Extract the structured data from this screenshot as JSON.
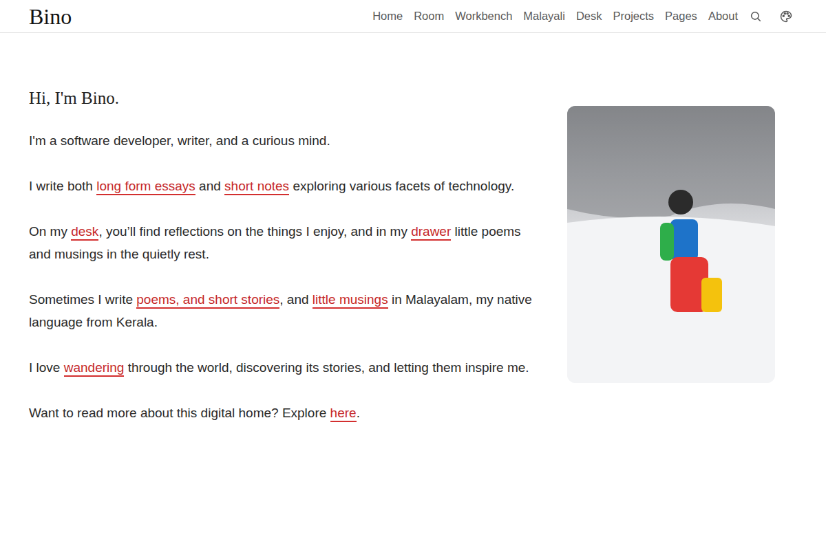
{
  "site": {
    "brand": "Bino"
  },
  "nav": {
    "items": [
      {
        "label": "Home",
        "selected": false
      },
      {
        "label": "Room",
        "selected": false
      },
      {
        "label": "Workbench",
        "selected": false
      },
      {
        "label": "Malayali",
        "selected": false
      },
      {
        "label": "Desk",
        "selected": false
      },
      {
        "label": "Projects",
        "selected": false
      },
      {
        "label": "Pages",
        "selected": false
      },
      {
        "label": "About",
        "selected": false
      }
    ]
  },
  "intro": {
    "heading": "Hi, I'm Bino.",
    "paragraphs": [
      {
        "segments": [
          {
            "kind": "text",
            "text": "I'm a software developer, writer, and a curious mind."
          }
        ]
      },
      {
        "segments": [
          {
            "kind": "text",
            "text": "I write both "
          },
          {
            "kind": "link",
            "text": "long form essays"
          },
          {
            "kind": "text",
            "text": " and "
          },
          {
            "kind": "link",
            "text": "short notes"
          },
          {
            "kind": "text",
            "text": " exploring various facets of technology."
          }
        ]
      },
      {
        "segments": [
          {
            "kind": "text",
            "text": "On my "
          },
          {
            "kind": "link",
            "text": "desk"
          },
          {
            "kind": "text",
            "text": ", you’ll find reflections on the things I enjoy, and in my "
          },
          {
            "kind": "link",
            "text": "drawer"
          },
          {
            "kind": "text",
            "text": " little poems and musings in the quietly rest."
          }
        ]
      },
      {
        "segments": [
          {
            "kind": "text",
            "text": "Sometimes I write "
          },
          {
            "kind": "link",
            "text": "poems, and short stories"
          },
          {
            "kind": "text",
            "text": ", and "
          },
          {
            "kind": "link",
            "text": "little musings"
          },
          {
            "kind": "text",
            "text": " in Malayalam, my native language from Kerala."
          }
        ]
      },
      {
        "segments": [
          {
            "kind": "text",
            "text": "I love "
          },
          {
            "kind": "link",
            "text": "wandering"
          },
          {
            "kind": "text",
            "text": " through the world, discovering its stories, and letting them inspire me."
          }
        ]
      },
      {
        "segments": [
          {
            "kind": "text",
            "text": "Want to read more about this digital home? Explore "
          },
          {
            "kind": "link",
            "text": "here"
          },
          {
            "kind": "text",
            "text": "."
          }
        ]
      }
    ]
  }
}
